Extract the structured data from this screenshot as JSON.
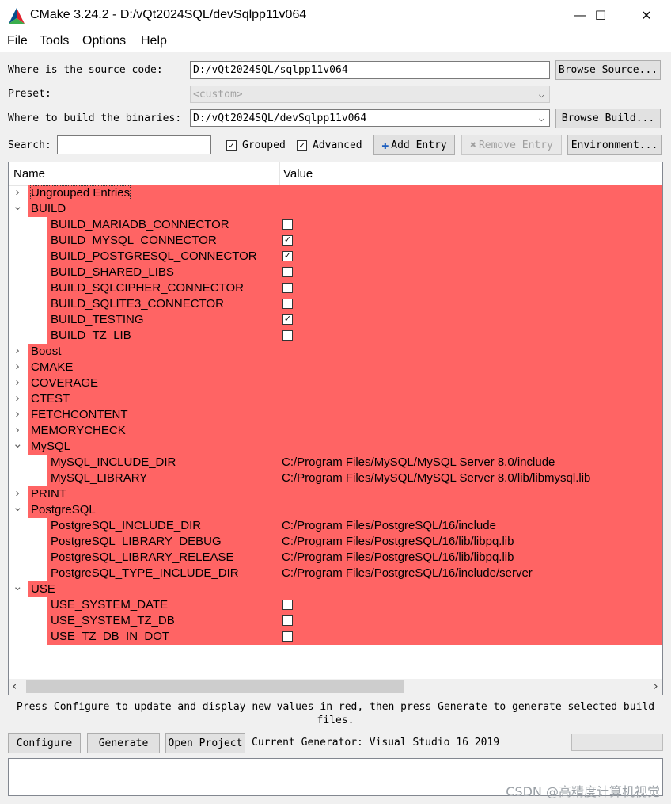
{
  "window": {
    "title": "CMake 3.24.2 - D:/vQt2024SQL/devSqlpp11v064",
    "controls": {
      "minimize": "—",
      "maximize": "☐",
      "close": "✕"
    }
  },
  "menu": [
    "File",
    "Tools",
    "Options",
    "Help"
  ],
  "source": {
    "label": "Where is the source code:",
    "value": "D:/vQt2024SQL/sqlpp11v064",
    "button": "Browse Source..."
  },
  "preset": {
    "label": "Preset:",
    "value": "<custom>"
  },
  "binaries": {
    "label": "Where to build the binaries:",
    "value": "D:/vQt2024SQL/devSqlpp11v064",
    "button": "Browse Build..."
  },
  "search": {
    "label": "Search:",
    "value": ""
  },
  "options": {
    "grouped": "Grouped",
    "advanced": "Advanced",
    "add_entry": "Add Entry",
    "remove_entry": "Remove Entry",
    "environment": "Environment..."
  },
  "tree": {
    "headers": {
      "name": "Name",
      "value": "Value"
    },
    "rows": [
      {
        "name": "Ungrouped Entries",
        "level": 0,
        "expanded": false,
        "value": "",
        "checkbox": null
      },
      {
        "name": "BUILD",
        "level": 0,
        "expanded": true,
        "value": "",
        "checkbox": null
      },
      {
        "name": "BUILD_MARIADB_CONNECTOR",
        "level": 1,
        "value": "",
        "checkbox": false
      },
      {
        "name": "BUILD_MYSQL_CONNECTOR",
        "level": 1,
        "value": "",
        "checkbox": true
      },
      {
        "name": "BUILD_POSTGRESQL_CONNECTOR",
        "level": 1,
        "value": "",
        "checkbox": true
      },
      {
        "name": "BUILD_SHARED_LIBS",
        "level": 1,
        "value": "",
        "checkbox": false
      },
      {
        "name": "BUILD_SQLCIPHER_CONNECTOR",
        "level": 1,
        "value": "",
        "checkbox": false
      },
      {
        "name": "BUILD_SQLITE3_CONNECTOR",
        "level": 1,
        "value": "",
        "checkbox": false
      },
      {
        "name": "BUILD_TESTING",
        "level": 1,
        "value": "",
        "checkbox": true
      },
      {
        "name": "BUILD_TZ_LIB",
        "level": 1,
        "value": "",
        "checkbox": false
      },
      {
        "name": "Boost",
        "level": 0,
        "expanded": false,
        "value": "",
        "checkbox": null
      },
      {
        "name": "CMAKE",
        "level": 0,
        "expanded": false,
        "value": "",
        "checkbox": null
      },
      {
        "name": "COVERAGE",
        "level": 0,
        "expanded": false,
        "value": "",
        "checkbox": null
      },
      {
        "name": "CTEST",
        "level": 0,
        "expanded": false,
        "value": "",
        "checkbox": null
      },
      {
        "name": "FETCHCONTENT",
        "level": 0,
        "expanded": false,
        "value": "",
        "checkbox": null
      },
      {
        "name": "MEMORYCHECK",
        "level": 0,
        "expanded": false,
        "value": "",
        "checkbox": null
      },
      {
        "name": "MySQL",
        "level": 0,
        "expanded": true,
        "value": "",
        "checkbox": null
      },
      {
        "name": "MySQL_INCLUDE_DIR",
        "level": 1,
        "value": "C:/Program Files/MySQL/MySQL Server 8.0/include",
        "checkbox": null
      },
      {
        "name": "MySQL_LIBRARY",
        "level": 1,
        "value": "C:/Program Files/MySQL/MySQL Server 8.0/lib/libmysql.lib",
        "checkbox": null
      },
      {
        "name": "PRINT",
        "level": 0,
        "expanded": false,
        "value": "",
        "checkbox": null
      },
      {
        "name": "PostgreSQL",
        "level": 0,
        "expanded": true,
        "value": "",
        "checkbox": null
      },
      {
        "name": "PostgreSQL_INCLUDE_DIR",
        "level": 1,
        "value": "C:/Program Files/PostgreSQL/16/include",
        "checkbox": null
      },
      {
        "name": "PostgreSQL_LIBRARY_DEBUG",
        "level": 1,
        "value": "C:/Program Files/PostgreSQL/16/lib/libpq.lib",
        "checkbox": null
      },
      {
        "name": "PostgreSQL_LIBRARY_RELEASE",
        "level": 1,
        "value": "C:/Program Files/PostgreSQL/16/lib/libpq.lib",
        "checkbox": null
      },
      {
        "name": "PostgreSQL_TYPE_INCLUDE_DIR",
        "level": 1,
        "value": "C:/Program Files/PostgreSQL/16/include/server",
        "checkbox": null
      },
      {
        "name": "USE",
        "level": 0,
        "expanded": true,
        "value": "",
        "checkbox": null
      },
      {
        "name": "USE_SYSTEM_DATE",
        "level": 1,
        "value": "",
        "checkbox": false
      },
      {
        "name": "USE_SYSTEM_TZ_DB",
        "level": 1,
        "value": "",
        "checkbox": false
      },
      {
        "name": "USE_TZ_DB_IN_DOT",
        "level": 1,
        "value": "",
        "checkbox": false
      }
    ]
  },
  "scroll": {
    "left": "‹",
    "right": "›"
  },
  "info_text": "Press Configure to update and display new values in red, then press Generate to generate selected build files.",
  "buttons": {
    "configure": "Configure",
    "generate": "Generate",
    "open_project": "Open Project"
  },
  "generator": "Current Generator: Visual Studio 16 2019",
  "watermark": "CSDN @高精度计算机视觉",
  "colors": {
    "new_value_bg": "#ff6464",
    "window_bg": "#f0f0f0"
  }
}
